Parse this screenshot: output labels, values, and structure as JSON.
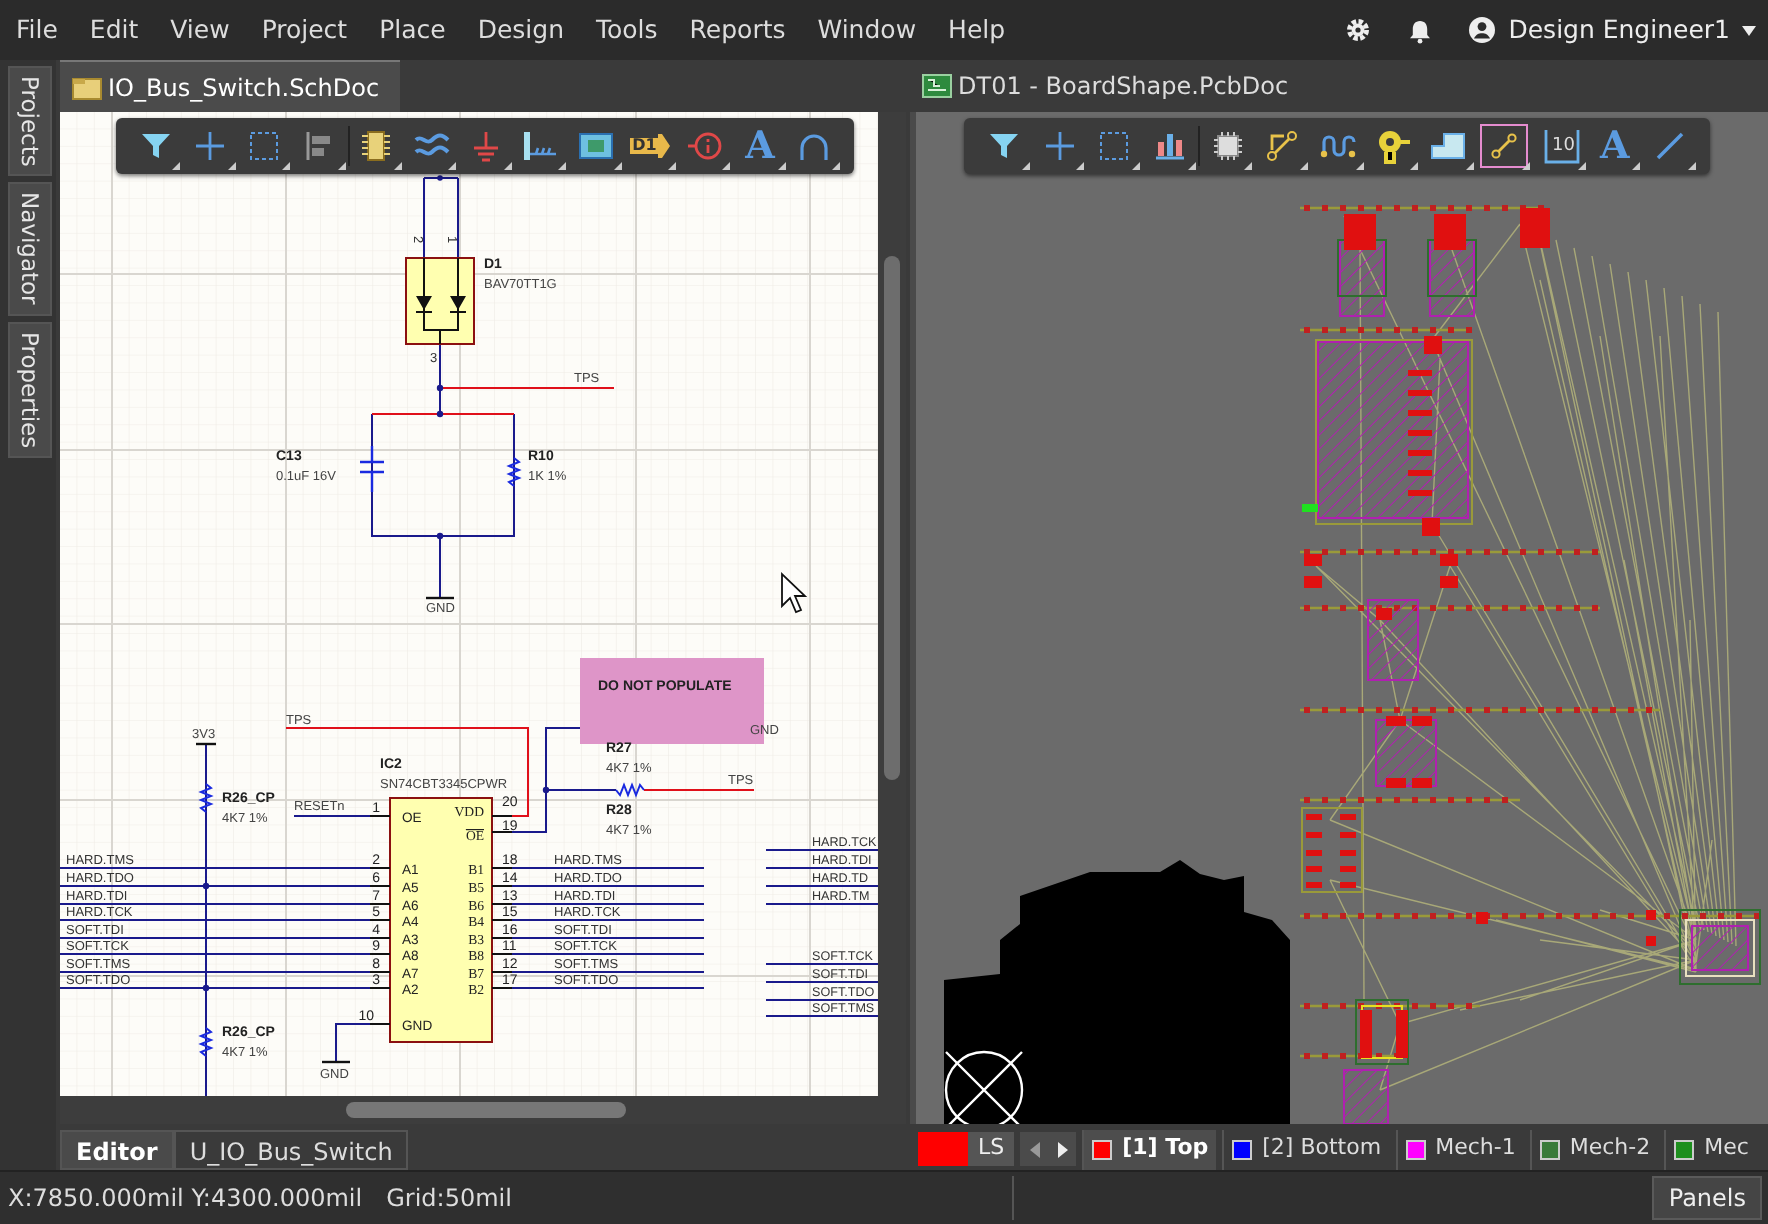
{
  "menu": [
    "File",
    "Edit",
    "View",
    "Project",
    "Place",
    "Design",
    "Tools",
    "Reports",
    "Window",
    "Help"
  ],
  "user": {
    "name": "Design Engineer1"
  },
  "side_panels": [
    "Projects",
    "Navigator",
    "Properties"
  ],
  "schematic": {
    "tab": {
      "title": "IO_Bus_Switch.SchDoc",
      "selected": true
    },
    "toolbar": [
      {
        "kind": "filter"
      },
      {
        "kind": "cross"
      },
      {
        "kind": "select"
      },
      {
        "kind": "align"
      },
      {
        "kind": "component"
      },
      {
        "kind": "wave"
      },
      {
        "kind": "ground"
      },
      {
        "kind": "port"
      },
      {
        "kind": "module"
      },
      {
        "kind": "tag",
        "glyph": "D1"
      },
      {
        "kind": "probe"
      },
      {
        "kind": "text",
        "glyph": "A"
      },
      {
        "kind": "arc"
      }
    ],
    "parts": [
      {
        "designator": "D1",
        "value": "BAV70TT1G"
      },
      {
        "designator": "C13",
        "value": "0.1uF 16V"
      },
      {
        "designator": "R10",
        "value": "1K 1%"
      },
      {
        "designator": "R27",
        "value": "4K7 1%"
      },
      {
        "designator": "R28",
        "value": "4K7 1%"
      },
      {
        "designator": "R26_CP",
        "value": "4K7 1%"
      },
      {
        "designator": "IC2",
        "value": "SN74CBT3345CPWR"
      },
      {
        "designator": "R26_CP",
        "value": "4K7 1%"
      }
    ],
    "diode_pins": [
      "2",
      "1",
      "3"
    ],
    "note": "DO NOT POPULATE",
    "power_ports": [
      "GND",
      "3V3",
      "GND",
      "GND"
    ],
    "net_labels": [
      "TPS",
      "TPS",
      "TPS",
      "RESETn"
    ],
    "ic_left_pins": [
      {
        "number": "1",
        "name": "OE"
      },
      {
        "number": "2",
        "name": "A1"
      },
      {
        "number": "6",
        "name": "A5"
      },
      {
        "number": "7",
        "name": "A6"
      },
      {
        "number": "5",
        "name": "A4"
      },
      {
        "number": "4",
        "name": "A3"
      },
      {
        "number": "9",
        "name": "A8"
      },
      {
        "number": "8",
        "name": "A7"
      },
      {
        "number": "3",
        "name": "A2"
      },
      {
        "number": "10",
        "name": "GND"
      }
    ],
    "ic_right_pins": [
      {
        "number": "20",
        "name": "VDD",
        "inverted": false
      },
      {
        "number": "19",
        "name": "OE",
        "inverted": true
      },
      {
        "number": "18",
        "name": "B1",
        "inverted": false
      },
      {
        "number": "14",
        "name": "B5",
        "inverted": false
      },
      {
        "number": "13",
        "name": "B6",
        "inverted": false
      },
      {
        "number": "15",
        "name": "B4",
        "inverted": false
      },
      {
        "number": "16",
        "name": "B3",
        "inverted": false
      },
      {
        "number": "11",
        "name": "B8",
        "inverted": false
      },
      {
        "number": "12",
        "name": "B7",
        "inverted": false
      },
      {
        "number": "17",
        "name": "B2",
        "inverted": false
      }
    ],
    "left_nets": [
      "HARD.TMS",
      "HARD.TDO",
      "HARD.TDI",
      "HARD.TCK",
      "SOFT.TDI",
      "SOFT.TCK",
      "SOFT.TMS",
      "SOFT.TDO"
    ],
    "right_nets": [
      "HARD.TMS",
      "HARD.TDO",
      "HARD.TDI",
      "HARD.TCK",
      "SOFT.TDI",
      "SOFT.TCK",
      "SOFT.TMS",
      "SOFT.TDO"
    ],
    "offsheet_nets": [
      "HARD.TCK",
      "HARD.TDI",
      "HARD.TD",
      "HARD.TM",
      "SOFT.TCK",
      "SOFT.TDI",
      "SOFT.TDO",
      "SOFT.TMS"
    ]
  },
  "editor_tabs": [
    {
      "label": "Editor",
      "selected": true
    },
    {
      "label": "U_IO_Bus_Switch",
      "selected": false
    }
  ],
  "pcb": {
    "tab": {
      "title": "DT01 - BoardShape.PcbDoc",
      "selected": false
    },
    "toolbar": [
      {
        "kind": "filter",
        "selected": false
      },
      {
        "kind": "cross",
        "selected": false
      },
      {
        "kind": "select",
        "selected": false
      },
      {
        "kind": "bars",
        "selected": false
      },
      {
        "kind": "chip",
        "selected": false
      },
      {
        "kind": "route",
        "selected": false
      },
      {
        "kind": "meander",
        "selected": false
      },
      {
        "kind": "keyhole",
        "selected": false
      },
      {
        "kind": "polygon",
        "selected": false
      },
      {
        "kind": "ratsnest",
        "selected": true
      },
      {
        "kind": "dimension",
        "glyph": "10",
        "selected": false
      },
      {
        "kind": "text",
        "glyph": "A",
        "selected": false
      },
      {
        "kind": "line",
        "selected": false
      }
    ],
    "current_layer": {
      "color": "#ff0000",
      "label": "LS"
    },
    "layers": [
      {
        "label": "[1] Top",
        "color": "#ff0000",
        "selected": true
      },
      {
        "label": "[2] Bottom",
        "color": "#0000ff",
        "selected": false
      },
      {
        "label": "Mech-1",
        "color": "#ff00ff",
        "selected": false
      },
      {
        "label": "Mech-2",
        "color": "#3a7a3a",
        "selected": false
      },
      {
        "label": "Mec",
        "color": "#1e8f1e",
        "selected": false
      }
    ]
  },
  "status_bar": {
    "coordinates": "X:7850.000mil Y:4300.000mil",
    "grid": "Grid:50mil",
    "panels_button": "Panels"
  }
}
